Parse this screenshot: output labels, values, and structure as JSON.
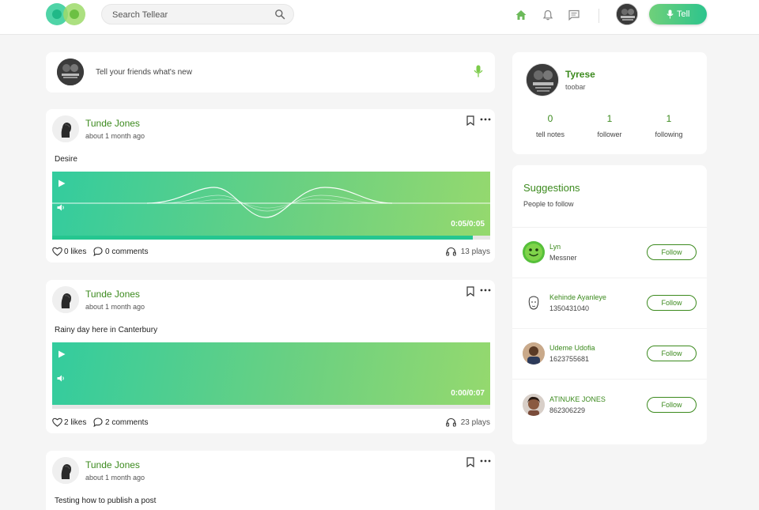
{
  "header": {
    "search_placeholder": "Search Tellear",
    "tell_label": "Tell",
    "icons": [
      "home-icon",
      "bell-icon",
      "messages-icon",
      "search-icon",
      "microphone-icon"
    ]
  },
  "compose": {
    "prompt": "Tell your friends what's new"
  },
  "posts": [
    {
      "author": "Tunde Jones",
      "time": "about 1 month ago",
      "text": "Desire",
      "timer": "0:05/0:05",
      "progress": 0.96,
      "likes": "0 likes",
      "comments": "0 comments",
      "plays": "13 plays"
    },
    {
      "author": "Tunde Jones",
      "time": "about 1 month ago",
      "text": "Rainy day here in Canterbury",
      "timer": "0:00/0:07",
      "progress": 0,
      "likes": "2 likes",
      "comments": "2 comments",
      "plays": "23 plays"
    },
    {
      "author": "Tunde Jones",
      "time": "about 1 month ago",
      "text": "Testing how to publish a post"
    }
  ],
  "profile": {
    "name": "Tyrese",
    "handle": "toobar",
    "stats": [
      {
        "value": "0",
        "label": "tell notes"
      },
      {
        "value": "1",
        "label": "follower"
      },
      {
        "value": "1",
        "label": "following"
      }
    ]
  },
  "suggestions": {
    "title": "Suggestions",
    "subtitle": "People to follow",
    "people": [
      {
        "name": "Lyn",
        "sub": "Messner",
        "button": "Follow"
      },
      {
        "name": "Kehinde Ayanleye",
        "sub": "1350431040",
        "button": "Follow"
      },
      {
        "name": "Udeme Udofia",
        "sub": "1623755681",
        "button": "Follow"
      },
      {
        "name": "ATINUKE JONES",
        "sub": "862306229",
        "button": "Follow"
      }
    ]
  },
  "colors": {
    "brand_green": "#3c8a1e",
    "accent_teal": "#25c690",
    "player_gradient_start": "#33cc9e",
    "player_gradient_end": "#95d96e"
  }
}
